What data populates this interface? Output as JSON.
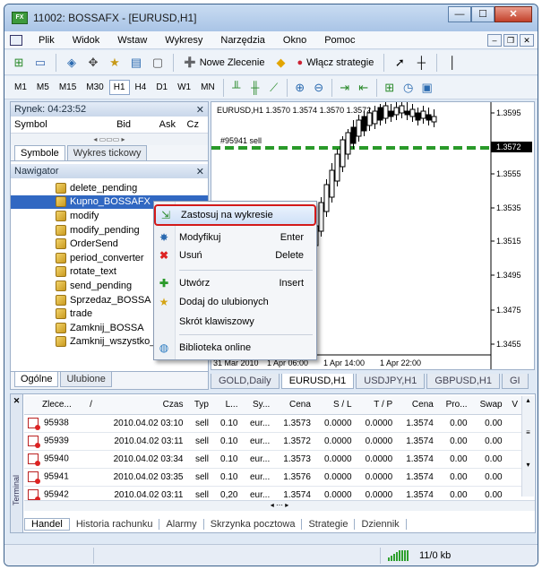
{
  "window": {
    "title": "11002: BOSSAFX - [EURUSD,H1]",
    "minimize": "—",
    "maximize": "☐",
    "close": "✕"
  },
  "menu": {
    "items": [
      "Plik",
      "Widok",
      "Wstaw",
      "Wykresy",
      "Narzędzia",
      "Okno",
      "Pomoc"
    ]
  },
  "toolbar": {
    "new_order": "Nowe Zlecenie",
    "enable_strategies": "Włącz strategie"
  },
  "timeframes": [
    "M1",
    "M5",
    "M15",
    "M30",
    "H1",
    "H4",
    "D1",
    "W1",
    "MN"
  ],
  "active_timeframe": "H1",
  "market": {
    "header": "Rynek: 04:23:52",
    "columns": [
      "Symbol",
      "Bid",
      "Ask",
      "Cz"
    ],
    "tabs": [
      "Symbole",
      "Wykres tickowy"
    ]
  },
  "navigator": {
    "header": "Nawigator",
    "items": [
      "delete_pending",
      "Kupno_BOSSAFX",
      "modify",
      "modify_pending",
      "OrderSend",
      "period_converter",
      "rotate_text",
      "send_pending",
      "Sprzedaz_BOSSA",
      "trade",
      "Zamknij_BOSSA",
      "Zamknij_wszystko_BOSSA"
    ],
    "selected_index": 1,
    "tabs": [
      "Ogólne",
      "Ulubione"
    ]
  },
  "chart": {
    "header": "EURUSD,H1  1.3570 1.3574 1.3570 1.3572",
    "order_label": "#95941 sell",
    "price_labels": [
      "1.3595",
      "1.3572",
      "1.3555",
      "1.3535",
      "1.3515",
      "1.3495",
      "1.3475",
      "1.3455"
    ],
    "current_price": "1.3572",
    "time_labels": [
      "31 Mar 2010",
      "1 Apr 06:00",
      "1 Apr 14:00",
      "1 Apr 22:00"
    ],
    "tabs": [
      "GOLD,Daily",
      "EURUSD,H1",
      "USDJPY,H1",
      "GBPUSD,H1",
      "GI"
    ],
    "active_tab": "EURUSD,H1",
    "colors": {
      "bull": "#ffffff",
      "bear": "#000000",
      "order_line": "#2a9a2a"
    }
  },
  "context_menu": {
    "items": [
      {
        "label": "Zastosuj na wykresie",
        "shortcut": "",
        "icon": "apply-chart-icon",
        "highlighted": true
      },
      {
        "label": "Modyfikuj",
        "shortcut": "Enter",
        "icon": "modify-gear-icon"
      },
      {
        "label": "Usuń",
        "shortcut": "Delete",
        "icon": "delete-x-icon"
      },
      {
        "label": "Utwórz",
        "shortcut": "Insert",
        "icon": "plus-icon"
      },
      {
        "label": "Dodaj do ulubionych",
        "shortcut": "",
        "icon": "favorite-star-icon"
      },
      {
        "label": "Skrót klawiszowy",
        "shortcut": "",
        "icon": ""
      },
      {
        "label": "Biblioteka online",
        "shortcut": "",
        "icon": "globe-icon"
      }
    ]
  },
  "terminal": {
    "side_label": "Terminal",
    "columns": [
      "Zlece...",
      "/",
      "Czas",
      "Typ",
      "L...",
      "Sy...",
      "Cena",
      "S / L",
      "T / P",
      "Cena",
      "Pro...",
      "Swap",
      "V"
    ],
    "rows": [
      [
        "95938",
        "",
        "2010.04.02 03:10",
        "sell",
        "0.10",
        "eur...",
        "1.3573",
        "0.0000",
        "0.0000",
        "1.3574",
        "0.00",
        "0.00"
      ],
      [
        "95939",
        "",
        "2010.04.02 03:11",
        "sell",
        "0.10",
        "eur...",
        "1.3572",
        "0.0000",
        "0.0000",
        "1.3574",
        "0.00",
        "0.00"
      ],
      [
        "95940",
        "",
        "2010.04.02 03:34",
        "sell",
        "0.10",
        "eur...",
        "1.3573",
        "0.0000",
        "0.0000",
        "1.3574",
        "0.00",
        "0.00"
      ],
      [
        "95941",
        "",
        "2010.04.02 03:35",
        "sell",
        "0.10",
        "eur...",
        "1.3576",
        "0.0000",
        "0.0000",
        "1.3574",
        "0.00",
        "0.00"
      ],
      [
        "95942",
        "",
        "2010.04.02 03:11",
        "sell",
        "0,20",
        "eur...",
        "1.3574",
        "0.0000",
        "0.0000",
        "1.3574",
        "0.00",
        "0.00"
      ]
    ],
    "tabs": [
      "Handel",
      "Historia rachunku",
      "Alarmy",
      "Skrzynka pocztowa",
      "Strategie",
      "Dziennik"
    ],
    "active_tab": "Handel"
  },
  "status": {
    "traffic": "11/0 kb"
  }
}
